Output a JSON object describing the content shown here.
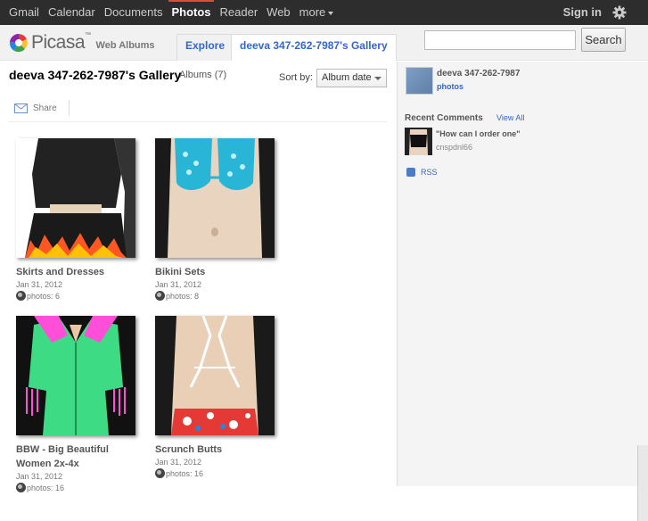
{
  "topnav": {
    "items": [
      "Gmail",
      "Calendar",
      "Documents",
      "Photos",
      "Reader",
      "Web",
      "more"
    ],
    "active": "Photos",
    "signin": "Sign in",
    "accent": "#dd4b39"
  },
  "header": {
    "logo_text": "Picasa",
    "logo_tm": "™",
    "logo_sub": "Web Albums",
    "tabs": [
      "Explore",
      "deeva 347-262-7987's Gallery"
    ],
    "search_button": "Search",
    "search_value": ""
  },
  "main": {
    "title": "deeva 347-262-7987's Gallery",
    "albums_count": "Albums (7)",
    "sort_label": "Sort by:",
    "sort_value": "Album date",
    "share_label": "Share",
    "albums": [
      {
        "title": "Skirts and Dresses",
        "date": "Jan 31, 2012",
        "photos": "photos: 6"
      },
      {
        "title": "Bikini Sets",
        "date": "Jan 31, 2012",
        "photos": "photos: 8"
      },
      {
        "title": "BBW - Big Beautiful Women 2x-4x",
        "date": "Jan 31, 2012",
        "photos": "photos: 16"
      },
      {
        "title": "Scrunch Butts",
        "date": "Jan 31, 2012",
        "photos": "photos: 16"
      }
    ]
  },
  "sidebar": {
    "owner_name": "deeva 347-262-7987",
    "owner_link": "photos",
    "recent_comments": "Recent Comments",
    "view_all": "View All",
    "comment_text": "\"How can I order one\"",
    "comment_user": "cnspdnl66",
    "rss": "RSS"
  }
}
